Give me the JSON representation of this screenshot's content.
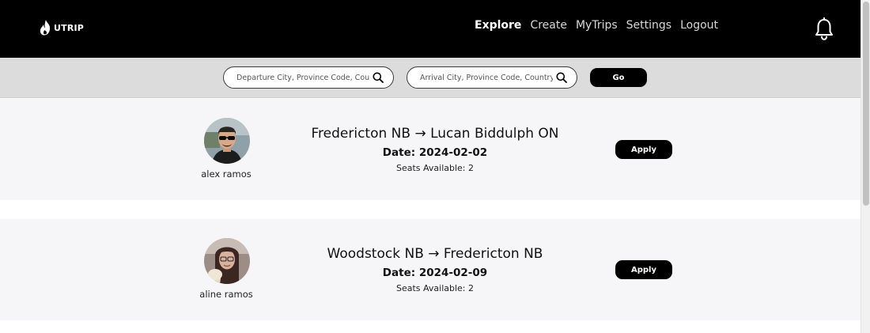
{
  "brand": {
    "name": "UTRIP"
  },
  "nav": {
    "items": [
      {
        "label": "Explore",
        "active": true
      },
      {
        "label": "Create",
        "active": false
      },
      {
        "label": "MyTrips",
        "active": false
      },
      {
        "label": "Settings",
        "active": false
      },
      {
        "label": "Logout",
        "active": false
      }
    ],
    "notification_icon": "bell-icon"
  },
  "search": {
    "departure_placeholder": "Departure City, Province Code, Country",
    "arrival_placeholder": "Arrival City, Province Code, Country",
    "departure_value": "",
    "arrival_value": "",
    "go_label": "Go",
    "icon": "search-icon"
  },
  "trips": [
    {
      "driver_name": "alex ramos",
      "route": "Fredericton NB → Lucan Biddulph ON",
      "date": "Date: 2024-02-02",
      "seats": "Seats Available: 2",
      "apply_label": "Apply"
    },
    {
      "driver_name": "aline ramos",
      "route": "Woodstock NB → Fredericton NB",
      "date": "Date: 2024-02-09",
      "seats": "Seats Available: 2",
      "apply_label": "Apply"
    }
  ],
  "colors": {
    "header_bg": "#000000",
    "search_bar_bg": "#dcdcdc",
    "card_bg": "#f6f6f8",
    "button_bg": "#000000",
    "button_text": "#ffffff"
  }
}
